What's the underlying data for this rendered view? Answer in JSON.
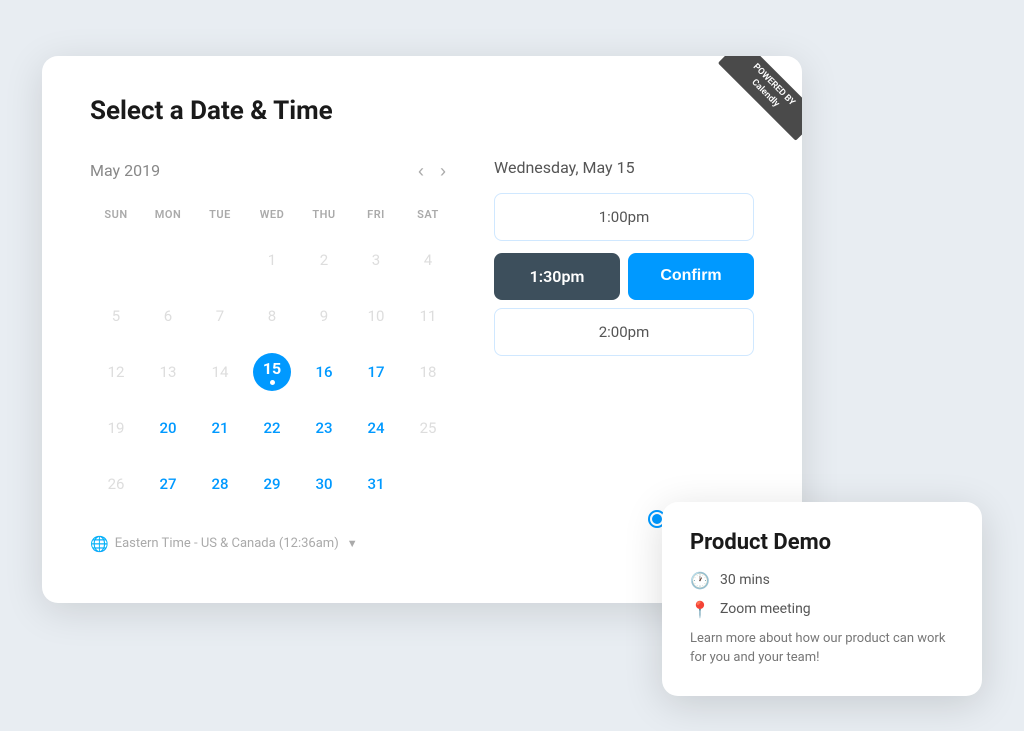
{
  "page": {
    "title": "Select a Date & Time"
  },
  "ribbon": {
    "line1": "POWERED BY",
    "line2": "Calendly"
  },
  "calendar": {
    "month_year": "May 2019",
    "day_headers": [
      "SUN",
      "MON",
      "TUE",
      "WED",
      "THU",
      "FRI",
      "SAT"
    ],
    "weeks": [
      [
        {
          "num": "",
          "state": "empty"
        },
        {
          "num": "",
          "state": "empty"
        },
        {
          "num": "",
          "state": "empty"
        },
        {
          "num": "1",
          "state": "dimmed"
        },
        {
          "num": "2",
          "state": "dimmed"
        },
        {
          "num": "3",
          "state": "dimmed"
        },
        {
          "num": "4",
          "state": "dimmed"
        }
      ],
      [
        {
          "num": "5",
          "state": "dimmed"
        },
        {
          "num": "6",
          "state": "dimmed"
        },
        {
          "num": "7",
          "state": "dimmed"
        },
        {
          "num": "8",
          "state": "dimmed"
        },
        {
          "num": "9",
          "state": "dimmed"
        },
        {
          "num": "10",
          "state": "dimmed"
        },
        {
          "num": "11",
          "state": "dimmed"
        }
      ],
      [
        {
          "num": "12",
          "state": "dimmed"
        },
        {
          "num": "13",
          "state": "dimmed"
        },
        {
          "num": "14",
          "state": "dimmed"
        },
        {
          "num": "15",
          "state": "selected"
        },
        {
          "num": "16",
          "state": "available"
        },
        {
          "num": "17",
          "state": "available"
        },
        {
          "num": "18",
          "state": "dimmed"
        }
      ],
      [
        {
          "num": "19",
          "state": "dimmed"
        },
        {
          "num": "20",
          "state": "available"
        },
        {
          "num": "21",
          "state": "available"
        },
        {
          "num": "22",
          "state": "available"
        },
        {
          "num": "23",
          "state": "available"
        },
        {
          "num": "24",
          "state": "available"
        },
        {
          "num": "25",
          "state": "dimmed"
        }
      ],
      [
        {
          "num": "26",
          "state": "dimmed"
        },
        {
          "num": "27",
          "state": "available"
        },
        {
          "num": "28",
          "state": "available"
        },
        {
          "num": "29",
          "state": "available"
        },
        {
          "num": "30",
          "state": "available"
        },
        {
          "num": "31",
          "state": "available"
        },
        {
          "num": "",
          "state": "empty"
        }
      ]
    ],
    "timezone": "Eastern Time - US & Canada (12:36am)"
  },
  "time_panel": {
    "date_label": "Wednesday, May 15",
    "slot_1": "1:00pm",
    "slot_selected": "1:30pm",
    "confirm_label": "Confirm",
    "slot_3": "2:00pm"
  },
  "demo_card": {
    "title": "Product Demo",
    "duration": "30 mins",
    "location": "Zoom meeting",
    "description": "Learn more about how our product can work for you and your team!"
  }
}
